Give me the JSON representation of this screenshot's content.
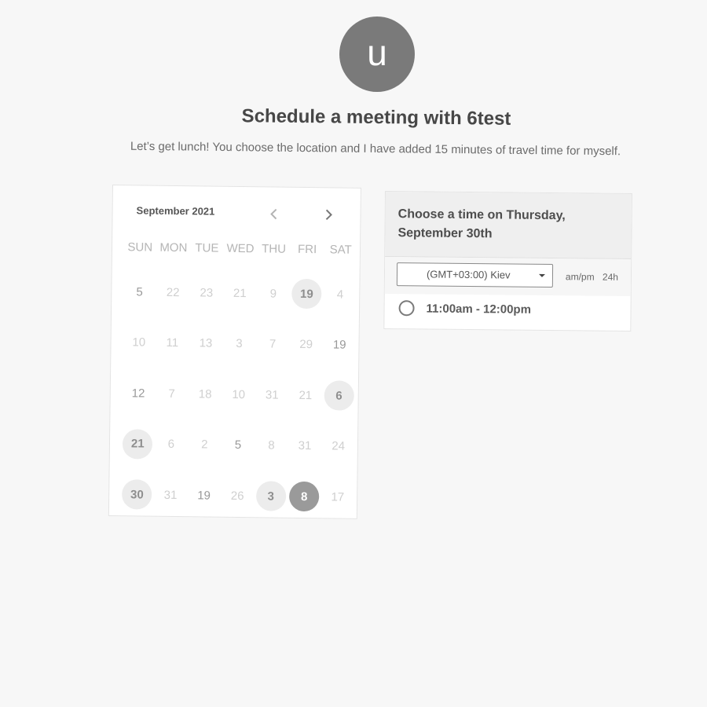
{
  "avatar": {
    "initial": "u"
  },
  "title": "Schedule a meeting with 6test",
  "subtitle": "Let’s get lunch! You choose the location and I have added 15 minutes of travel time for myself.",
  "calendar": {
    "month_label": "September 2021",
    "prev_icon": "chevron-left-icon",
    "next_icon": "chevron-right-icon",
    "weekdays": [
      "SUN",
      "MON",
      "TUE",
      "WED",
      "THU",
      "FRI",
      "SAT"
    ],
    "weeks": [
      [
        {
          "d": "5",
          "s": "dark"
        },
        {
          "d": "22",
          "s": "muted"
        },
        {
          "d": "23",
          "s": "muted"
        },
        {
          "d": "21",
          "s": "muted"
        },
        {
          "d": "9",
          "s": "muted"
        },
        {
          "d": "19",
          "s": "avail"
        },
        {
          "d": "4",
          "s": "muted"
        }
      ],
      [
        {
          "d": "10",
          "s": "muted"
        },
        {
          "d": "11",
          "s": "muted"
        },
        {
          "d": "13",
          "s": "muted"
        },
        {
          "d": "3",
          "s": "muted"
        },
        {
          "d": "7",
          "s": "muted"
        },
        {
          "d": "29",
          "s": "muted"
        },
        {
          "d": "19",
          "s": "dark"
        }
      ],
      [
        {
          "d": "12",
          "s": "dark"
        },
        {
          "d": "7",
          "s": "muted"
        },
        {
          "d": "18",
          "s": "muted"
        },
        {
          "d": "10",
          "s": "muted"
        },
        {
          "d": "31",
          "s": "muted"
        },
        {
          "d": "21",
          "s": "muted"
        },
        {
          "d": "6",
          "s": "avail"
        }
      ],
      [
        {
          "d": "21",
          "s": "avail"
        },
        {
          "d": "6",
          "s": "muted"
        },
        {
          "d": "2",
          "s": "muted"
        },
        {
          "d": "5",
          "s": "dark"
        },
        {
          "d": "8",
          "s": "muted"
        },
        {
          "d": "31",
          "s": "muted"
        },
        {
          "d": "24",
          "s": "muted"
        }
      ],
      [
        {
          "d": "30",
          "s": "avail"
        },
        {
          "d": "31",
          "s": "muted"
        },
        {
          "d": "19",
          "s": "dark"
        },
        {
          "d": "26",
          "s": "muted"
        },
        {
          "d": "3",
          "s": "avail"
        },
        {
          "d": "8",
          "s": "sel"
        },
        {
          "d": "17",
          "s": "muted"
        }
      ]
    ]
  },
  "time_panel": {
    "heading": "Choose a time on Thursday, September 30th",
    "timezone": "(GMT+03:00) Kiev",
    "format_ampm": "am/pm",
    "format_24h": "24h",
    "slots": [
      "11:00am - 12:00pm"
    ]
  }
}
